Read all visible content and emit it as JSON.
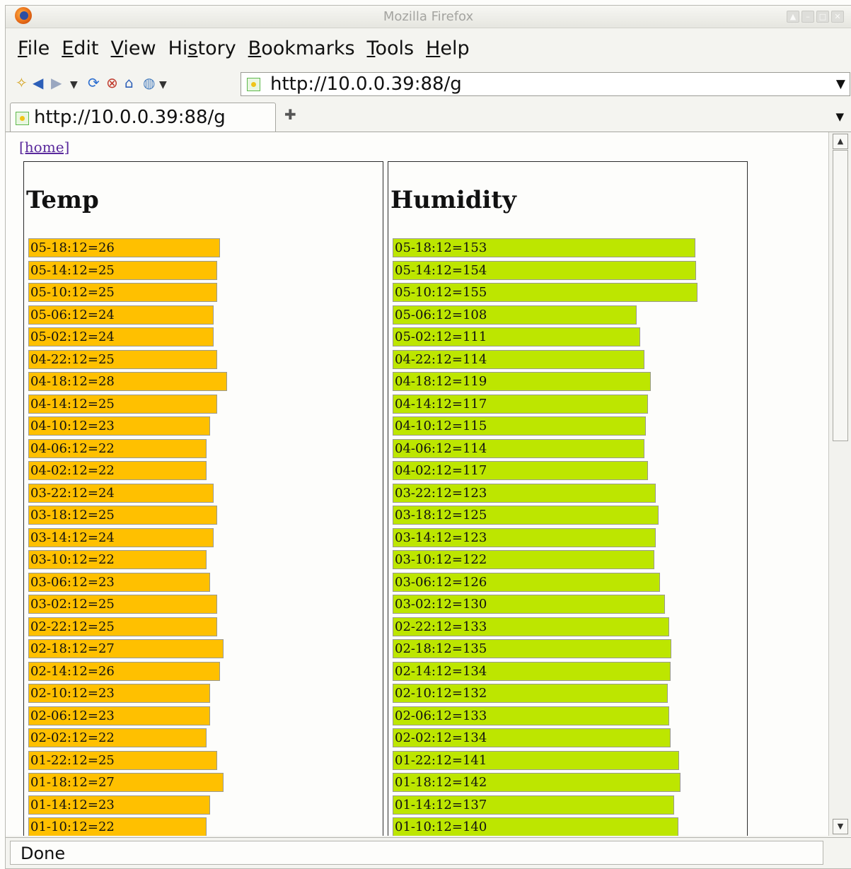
{
  "window": {
    "title": "Mozilla Firefox"
  },
  "menu": [
    {
      "pre": "",
      "acc": "F",
      "post": "ile"
    },
    {
      "pre": "",
      "acc": "E",
      "post": "dit"
    },
    {
      "pre": "",
      "acc": "V",
      "post": "iew"
    },
    {
      "pre": "Hi",
      "acc": "s",
      "post": "tory"
    },
    {
      "pre": "",
      "acc": "B",
      "post": "ookmarks"
    },
    {
      "pre": "",
      "acc": "T",
      "post": "ools"
    },
    {
      "pre": "",
      "acc": "H",
      "post": "elp"
    }
  ],
  "address": {
    "url": "http://10.0.0.39:88/g"
  },
  "tab": {
    "title": "http://10.0.0.39:88/g"
  },
  "page": {
    "home_link": "[home]",
    "temp": {
      "heading": "Temp",
      "color": "#ffc000",
      "rows": [
        {
          "label": "05-18:12=26",
          "value": 26
        },
        {
          "label": "05-14:12=25",
          "value": 25
        },
        {
          "label": "05-10:12=25",
          "value": 25
        },
        {
          "label": "05-06:12=24",
          "value": 24
        },
        {
          "label": "05-02:12=24",
          "value": 24
        },
        {
          "label": "04-22:12=25",
          "value": 25
        },
        {
          "label": "04-18:12=28",
          "value": 28
        },
        {
          "label": "04-14:12=25",
          "value": 25
        },
        {
          "label": "04-10:12=23",
          "value": 23
        },
        {
          "label": "04-06:12=22",
          "value": 22
        },
        {
          "label": "04-02:12=22",
          "value": 22
        },
        {
          "label": "03-22:12=24",
          "value": 24
        },
        {
          "label": "03-18:12=25",
          "value": 25
        },
        {
          "label": "03-14:12=24",
          "value": 24
        },
        {
          "label": "03-10:12=22",
          "value": 22
        },
        {
          "label": "03-06:12=23",
          "value": 23
        },
        {
          "label": "03-02:12=25",
          "value": 25
        },
        {
          "label": "02-22:12=25",
          "value": 25
        },
        {
          "label": "02-18:12=27",
          "value": 27
        },
        {
          "label": "02-14:12=26",
          "value": 26
        },
        {
          "label": "02-10:12=23",
          "value": 23
        },
        {
          "label": "02-06:12=23",
          "value": 23
        },
        {
          "label": "02-02:12=22",
          "value": 22
        },
        {
          "label": "01-22:12=25",
          "value": 25
        },
        {
          "label": "01-18:12=27",
          "value": 27
        },
        {
          "label": "01-14:12=23",
          "value": 23
        },
        {
          "label": "01-10:12=22",
          "value": 22
        }
      ]
    },
    "humidity": {
      "heading": "Humidity",
      "color": "#bde600",
      "rows": [
        {
          "label": "05-18:12=153",
          "value": 153
        },
        {
          "label": "05-14:12=154",
          "value": 154
        },
        {
          "label": "05-10:12=155",
          "value": 155
        },
        {
          "label": "05-06:12=108",
          "value": 108
        },
        {
          "label": "05-02:12=111",
          "value": 111
        },
        {
          "label": "04-22:12=114",
          "value": 114
        },
        {
          "label": "04-18:12=119",
          "value": 119
        },
        {
          "label": "04-14:12=117",
          "value": 117
        },
        {
          "label": "04-10:12=115",
          "value": 115
        },
        {
          "label": "04-06:12=114",
          "value": 114
        },
        {
          "label": "04-02:12=117",
          "value": 117
        },
        {
          "label": "03-22:12=123",
          "value": 123
        },
        {
          "label": "03-18:12=125",
          "value": 125
        },
        {
          "label": "03-14:12=123",
          "value": 123
        },
        {
          "label": "03-10:12=122",
          "value": 122
        },
        {
          "label": "03-06:12=126",
          "value": 126
        },
        {
          "label": "03-02:12=130",
          "value": 130
        },
        {
          "label": "02-22:12=133",
          "value": 133
        },
        {
          "label": "02-18:12=135",
          "value": 135
        },
        {
          "label": "02-14:12=134",
          "value": 134
        },
        {
          "label": "02-10:12=132",
          "value": 132
        },
        {
          "label": "02-06:12=133",
          "value": 133
        },
        {
          "label": "02-02:12=134",
          "value": 134
        },
        {
          "label": "01-22:12=141",
          "value": 141
        },
        {
          "label": "01-18:12=142",
          "value": 142
        },
        {
          "label": "01-14:12=137",
          "value": 137
        },
        {
          "label": "01-10:12=140",
          "value": 140
        }
      ]
    }
  },
  "status": {
    "text": "Done"
  }
}
